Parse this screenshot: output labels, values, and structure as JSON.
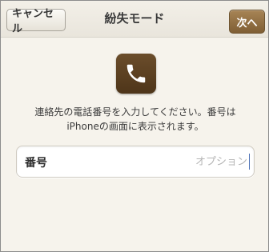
{
  "navbar": {
    "cancel_label": "キャンセル",
    "title": "紛失モード",
    "next_label": "次へ"
  },
  "icon": {
    "name": "phone-icon",
    "tile_color": "#5d4122"
  },
  "message": {
    "line1": "連絡先の電話番号を入力してください。番号は",
    "line2": "iPhoneの画面に表示されます。"
  },
  "phone_field": {
    "label": "番号",
    "value": "",
    "placeholder": "オプション"
  },
  "colors": {
    "accent": "#8a6a3f",
    "background": "#f6f3ec"
  }
}
